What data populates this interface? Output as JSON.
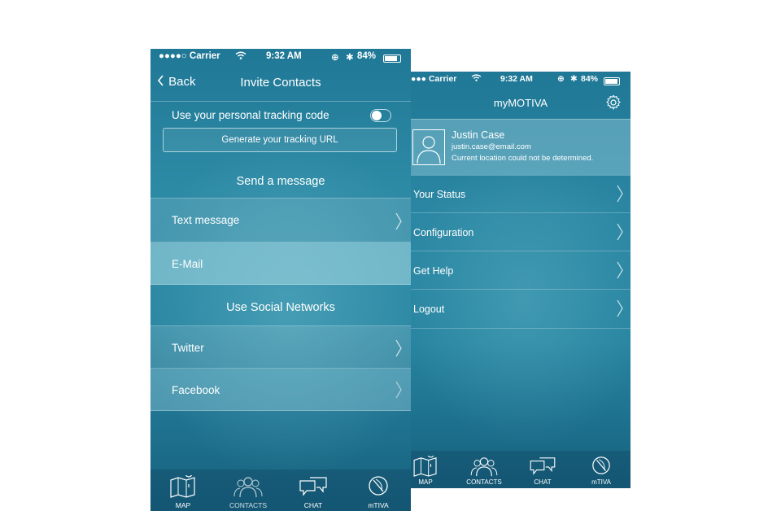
{
  "invite_screen": {
    "status": {
      "carrier": "●●●●○ Carrier",
      "time": "9:32 AM",
      "battery": "84%"
    },
    "nav": {
      "back_label": "Back",
      "title": "Invite Contacts"
    },
    "tracking": {
      "toggle_label": "Use your personal tracking code",
      "generate_button": "Generate your tracking URL"
    },
    "send_section": {
      "title": "Send a message",
      "items": [
        "Text message",
        "E-Mail"
      ]
    },
    "social_section": {
      "title": "Use Social Networks",
      "items": [
        "Twitter",
        "Facebook"
      ]
    },
    "tabs": [
      {
        "label": "MAP",
        "icon": "map-icon"
      },
      {
        "label": "CONTACTS",
        "icon": "contacts-icon"
      },
      {
        "label": "CHAT",
        "icon": "chat-icon"
      },
      {
        "label": "mTIVA",
        "icon": "mtiva-icon"
      }
    ]
  },
  "profile_screen": {
    "status": {
      "carrier": "●●● Carrier",
      "time": "9:32 AM",
      "battery": "84%"
    },
    "nav": {
      "title": "myMOTIVA",
      "settings_icon": "gear-icon"
    },
    "profile": {
      "name": "Justin Case",
      "email": "justin.case@email.com",
      "location": "Current location could not be determined."
    },
    "menu": [
      "Your Status",
      "Configuration",
      "Get Help",
      "Logout"
    ],
    "tabs": [
      {
        "label": "MAP",
        "icon": "map-icon"
      },
      {
        "label": "CONTACTS",
        "icon": "contacts-icon"
      },
      {
        "label": "CHAT",
        "icon": "chat-icon"
      },
      {
        "label": "mTIVA",
        "icon": "mtiva-icon"
      }
    ]
  },
  "colors": {
    "accent": "#2a86a2",
    "dark": "#155e7a",
    "highlight": "#9fd3df"
  }
}
